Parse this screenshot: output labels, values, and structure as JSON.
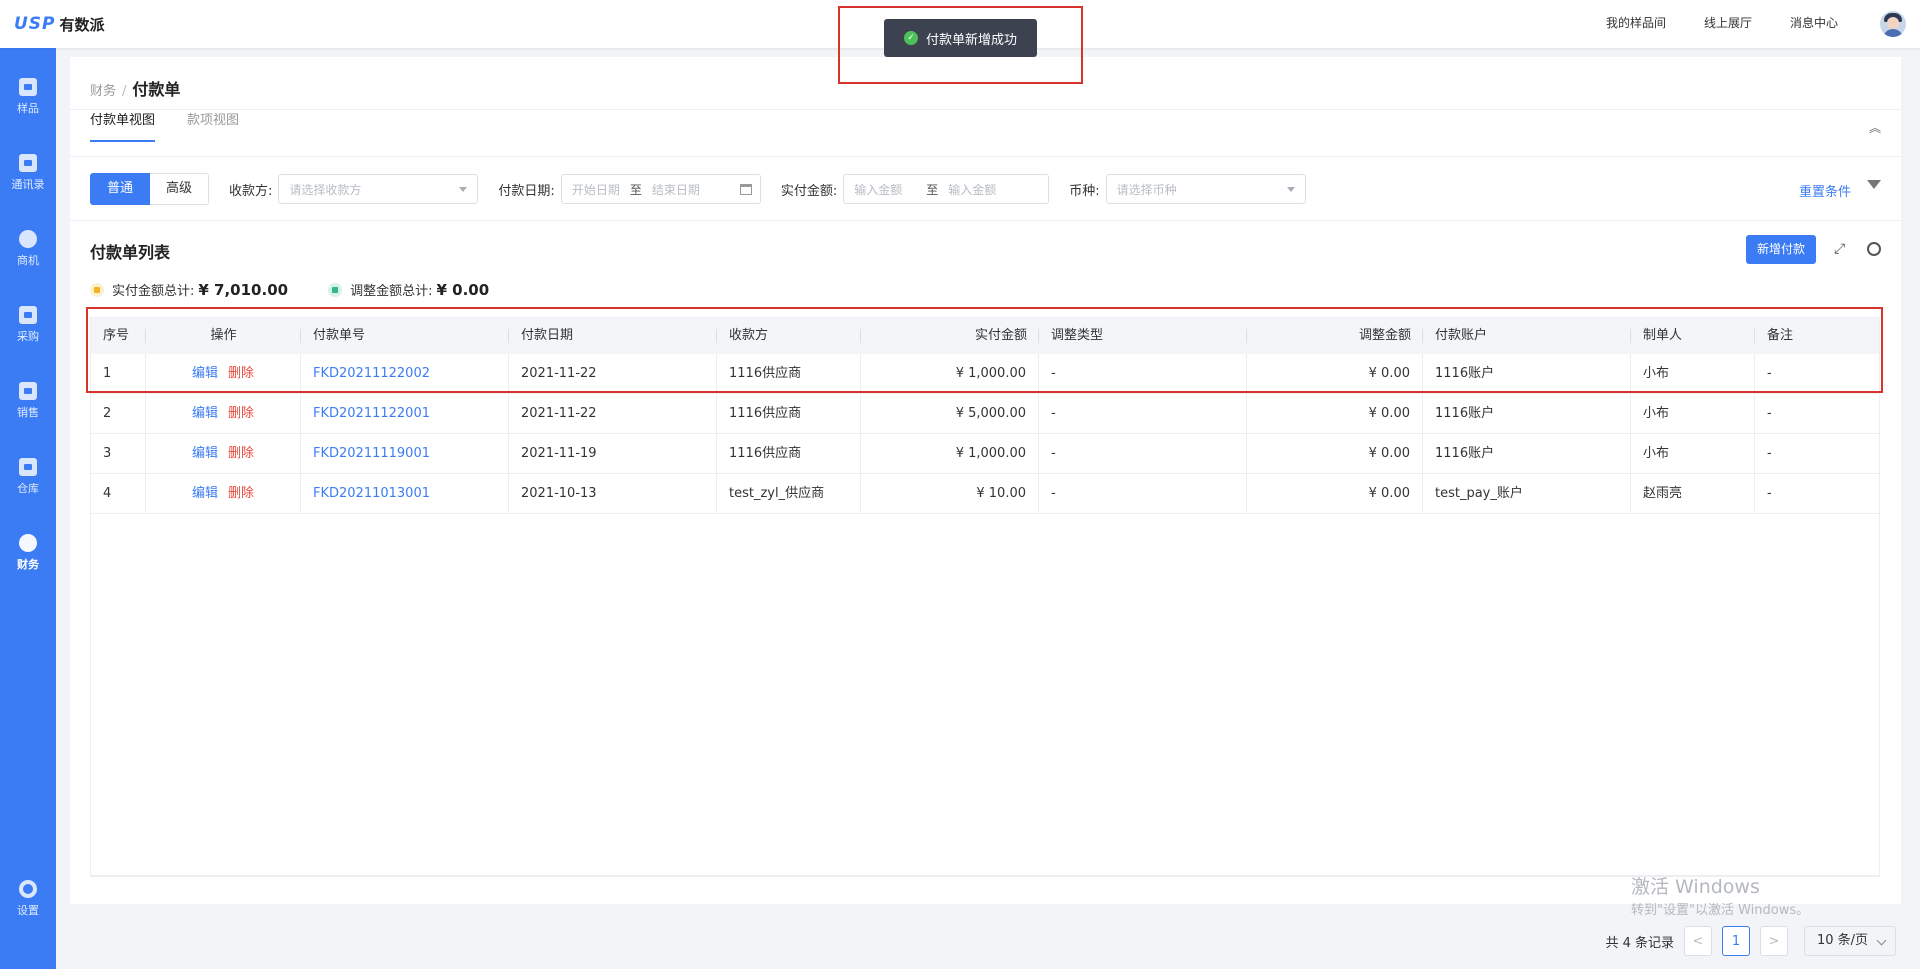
{
  "brand": {
    "mark": "USP",
    "name": "有数派"
  },
  "topnav": [
    "我的样品间",
    "线上展厅",
    "消息中心"
  ],
  "toast": "付款单新增成功",
  "sidebar": [
    "样品",
    "通讯录",
    "商机",
    "采购",
    "销售",
    "仓库",
    "财务",
    "设置"
  ],
  "breadcrumb": {
    "parent": "财务",
    "sep": "/",
    "current": "付款单"
  },
  "tabs": [
    "付款单视图",
    "款项视图"
  ],
  "filter": {
    "mode_normal": "普通",
    "mode_advanced": "高级",
    "payee_label": "收款方:",
    "payee_placeholder": "请选择收款方",
    "date_label": "付款日期:",
    "date_start": "开始日期",
    "to": "至",
    "date_end": "结束日期",
    "amount_label": "实付金额:",
    "amount_min": "输入金额",
    "amount_max": "输入金额",
    "currency_label": "币种:",
    "currency_placeholder": "请选择币种",
    "reset": "重置条件"
  },
  "list": {
    "title": "付款单列表",
    "add_button": "新增付款",
    "total_paid_label": "实付金额总计:",
    "total_paid_value": "¥ 7,010.00",
    "total_adjust_label": "调整金额总计:",
    "total_adjust_value": "¥ 0.00"
  },
  "table": {
    "columns": [
      "序号",
      "操作",
      "付款单号",
      "付款日期",
      "收款方",
      "实付金额",
      "调整类型",
      "调整金额",
      "付款账户",
      "制单人",
      "备注"
    ],
    "edit": "编辑",
    "delete": "删除",
    "rows": [
      {
        "no": "1",
        "code": "FKD20211122002",
        "date": "2021-11-22",
        "payee": "1116供应商",
        "paid": "¥ 1,000.00",
        "adj_type": "-",
        "adj": "¥ 0.00",
        "account": "1116账户",
        "maker": "小布",
        "note": "-"
      },
      {
        "no": "2",
        "code": "FKD20211122001",
        "date": "2021-11-22",
        "payee": "1116供应商",
        "paid": "¥ 5,000.00",
        "adj_type": "-",
        "adj": "¥ 0.00",
        "account": "1116账户",
        "maker": "小布",
        "note": "-"
      },
      {
        "no": "3",
        "code": "FKD20211119001",
        "date": "2021-11-19",
        "payee": "1116供应商",
        "paid": "¥ 1,000.00",
        "adj_type": "-",
        "adj": "¥ 0.00",
        "account": "1116账户",
        "maker": "小布",
        "note": "-"
      },
      {
        "no": "4",
        "code": "FKD20211013001",
        "date": "2021-10-13",
        "payee": "test_zyl_供应商",
        "paid": "¥ 10.00",
        "adj_type": "-",
        "adj": "¥ 0.00",
        "account": "test_pay_账户",
        "maker": "赵雨亮",
        "note": "-"
      }
    ]
  },
  "watermark": {
    "line1": "激活 Windows",
    "line2": "转到\"设置\"以激活 Windows。"
  },
  "pager": {
    "total": "共 4 条记录",
    "prev": "<",
    "page": "1",
    "next": ">",
    "size": "10 条/页"
  }
}
